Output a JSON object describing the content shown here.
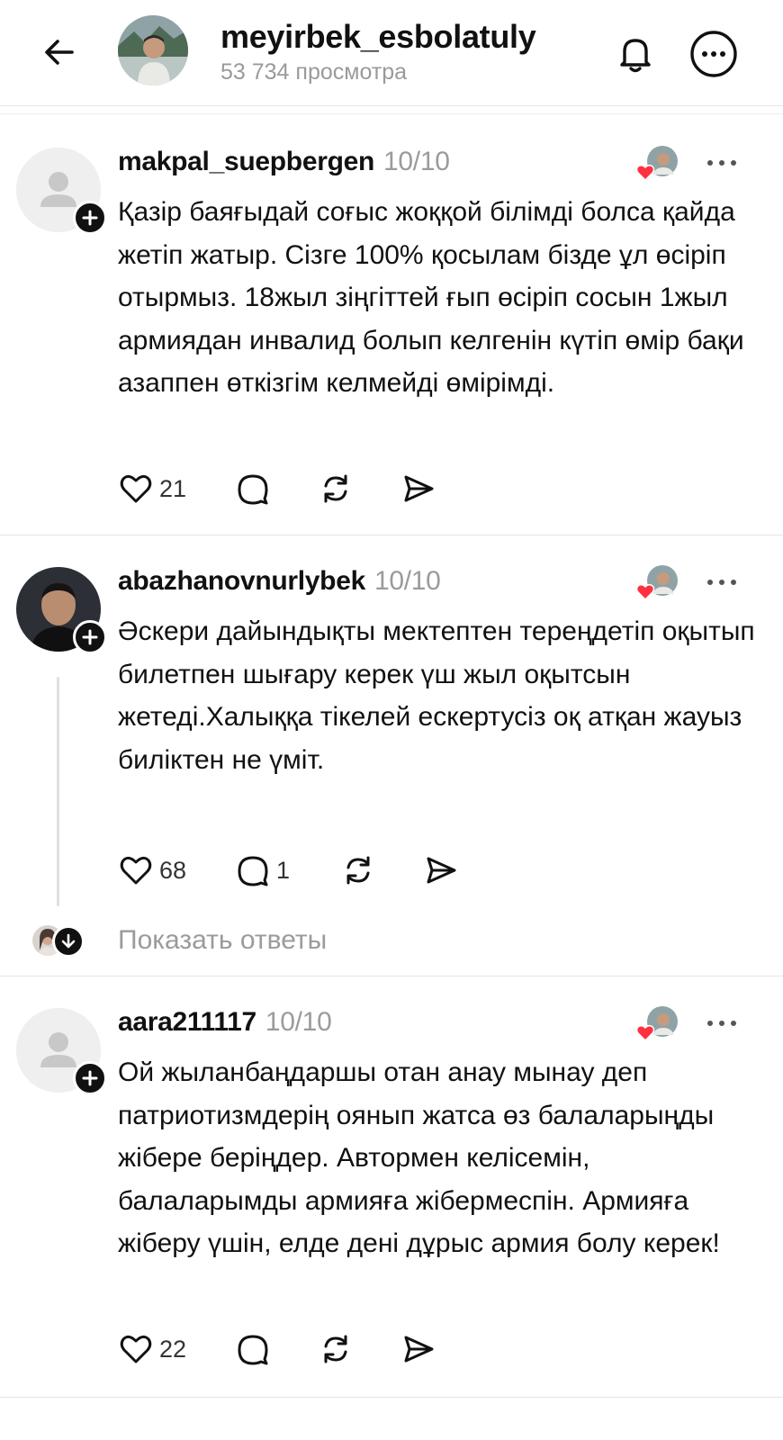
{
  "header": {
    "title": "meyirbek_esbolatuly",
    "subtitle": "53 734 просмотра"
  },
  "posts": [
    {
      "username": "makpal_suepbergen",
      "date": "10/10",
      "text": "Қазір баяғыдай соғыс жоққой білімді болса қайда жетіп жатыр. Сізге 100% қосылам бізде ұл өсіріп отырмыз. 18жыл зіңгіттей ғып өсіріп сосын 1жыл армиядан инвалид болып келгенін күтіп өмір бақи азаппен өткізгім келмейді өмірімді.",
      "likes": "21",
      "replies": ""
    },
    {
      "username": "abazhanovnurlybek",
      "date": "10/10",
      "text": "Әскери дайындықты мектептен тереңдетіп оқытып  билетпен шығару керек үш жыл оқытсын жетеді.Халыққа тікелей ескертусіз оқ атқан жауыз биліктен не үміт.",
      "likes": "68",
      "replies": "1"
    },
    {
      "username": "aara211117",
      "date": "10/10",
      "text": "Ой жыланбаңдаршы отан анау мынау деп патриотизмдерің оянып жатса өз балаларыңды жібере беріңдер. Автормен келісемін, балаларымды армияға жібермеспін. Армияға жіберу үшін, елде дені дұрыс армия болу керек!",
      "likes": "22",
      "replies": ""
    }
  ],
  "show_replies_label": "Показать ответы",
  "colors": {
    "text": "#111111",
    "muted": "#9b9b9b",
    "heart": "#ff3040",
    "divider": "#e4e4e4"
  },
  "icons": [
    "back-arrow-icon",
    "bell-icon",
    "more-circle-icon",
    "heart-icon",
    "comment-icon",
    "repost-icon",
    "share-icon",
    "plus-icon",
    "arrow-down-icon"
  ]
}
